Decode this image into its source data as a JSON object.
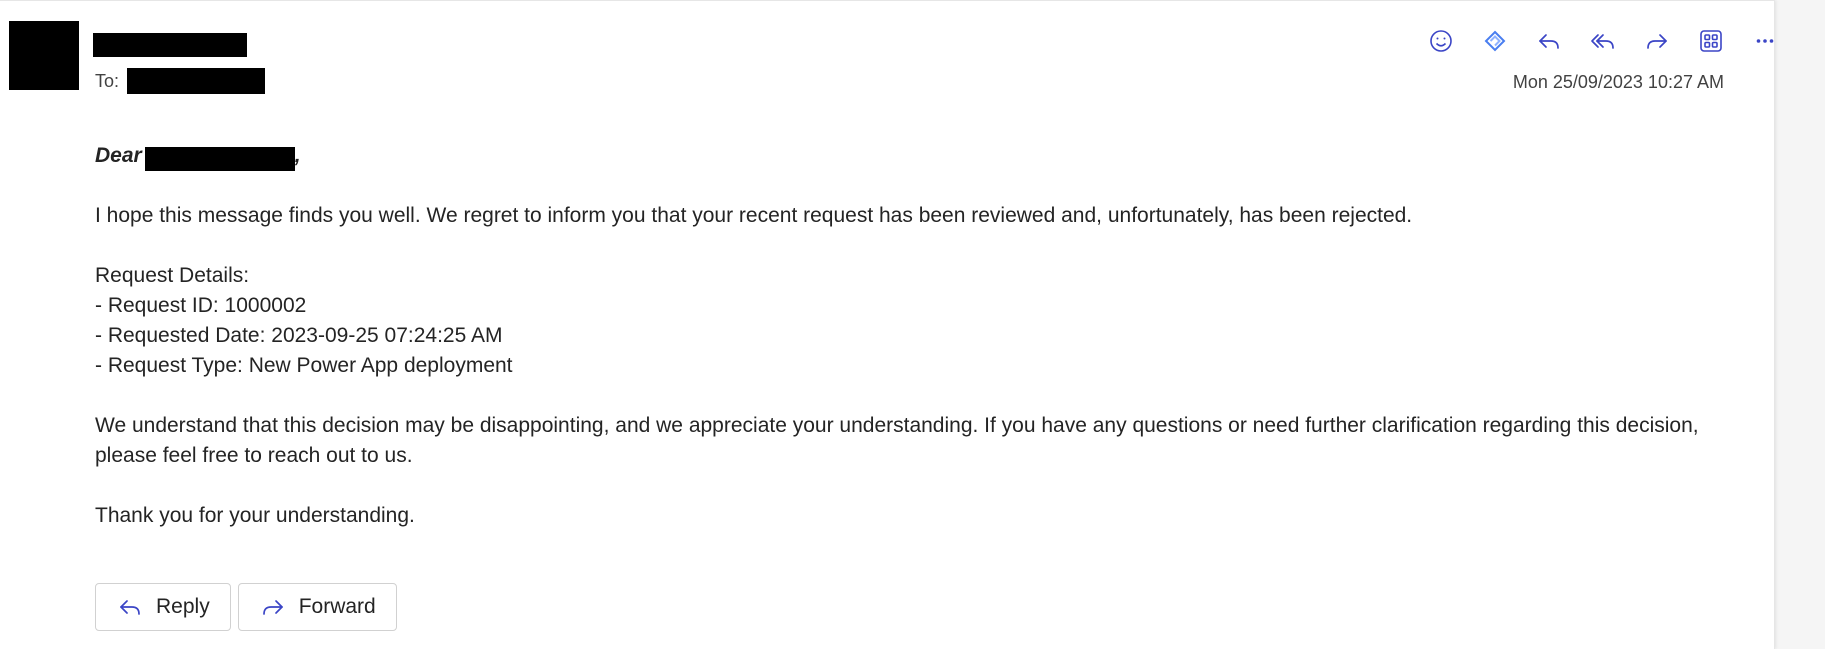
{
  "header": {
    "to_label": "To:",
    "timestamp": "Mon 25/09/2023 10:27 AM",
    "toolbar": [
      {
        "name": "emoji-icon",
        "label": "React"
      },
      {
        "name": "loop-icon",
        "label": "Loop"
      },
      {
        "name": "reply-icon",
        "label": "Reply"
      },
      {
        "name": "reply-all-icon",
        "label": "Reply all"
      },
      {
        "name": "forward-icon",
        "label": "Forward"
      },
      {
        "name": "apps-icon",
        "label": "Apps"
      },
      {
        "name": "more-icon",
        "label": "More actions"
      }
    ],
    "accent": "#3b45c6"
  },
  "message": {
    "greeting": "Dear",
    "greeting_suffix": ",",
    "paragraph1": "I hope this message finds you well. We regret to inform you that your recent request has been reviewed and, unfortunately, has been rejected.",
    "details_title": "Request Details:",
    "detail_id": "- Request ID: 1000002",
    "detail_date": "- Requested Date: 2023-09-25 07:24:25 AM",
    "detail_type": "- Request Type: New Power App deployment",
    "paragraph2": "We understand that this decision may be disappointing, and we appreciate your understanding. If you have any questions or need further clarification regarding this decision, please feel free to reach out to us.",
    "closing": "Thank you for your understanding."
  },
  "actions": {
    "reply_label": "Reply",
    "forward_label": "Forward"
  }
}
